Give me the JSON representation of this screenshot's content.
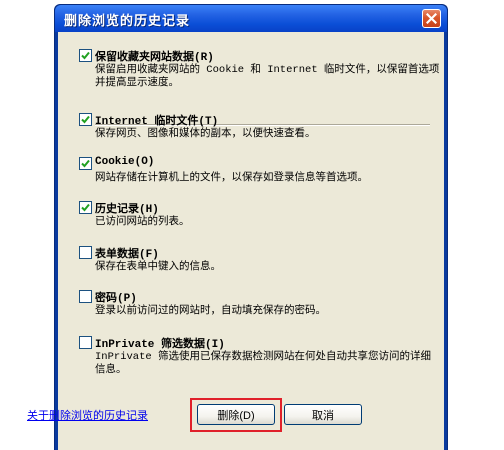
{
  "window": {
    "title": "删除浏览的历史记录",
    "close_icon": "close-icon"
  },
  "options": [
    {
      "id": "favorites",
      "checked": true,
      "label": "保留收藏夹网站数据(R)",
      "desc": "保留启用收藏夹网站的 Cookie 和 Internet 临时文件，以保留首选项并提高显示速度。"
    },
    {
      "id": "temp-files",
      "checked": true,
      "label": "Internet 临时文件(T)",
      "desc": "保存网页、图像和媒体的副本，以便快速查看。"
    },
    {
      "id": "cookies",
      "checked": true,
      "label": "Cookie(O)",
      "desc": "网站存储在计算机上的文件，以保存如登录信息等首选项。"
    },
    {
      "id": "history",
      "checked": true,
      "label": "历史记录(H)",
      "desc": "已访问网站的列表。"
    },
    {
      "id": "form-data",
      "checked": false,
      "label": "表单数据(F)",
      "desc": "保存在表单中键入的信息。"
    },
    {
      "id": "passwords",
      "checked": false,
      "label": "密码(P)",
      "desc": "登录以前访问过的网站时，自动填充保存的密码。"
    },
    {
      "id": "inprivate",
      "checked": false,
      "label": "InPrivate 筛选数据(I)",
      "desc": "InPrivate 筛选使用已保存数据检测网站在何处自动共享您访问的详细信息。"
    }
  ],
  "footer": {
    "link": "关于删除浏览的历史记录",
    "delete_label": "删除(D)",
    "cancel_label": "取消"
  },
  "colors": {
    "titlebar": "#0b4fd7",
    "dialog_bg": "#ece9d8",
    "checkmark": "#21a121",
    "highlight": "#e0202a"
  }
}
